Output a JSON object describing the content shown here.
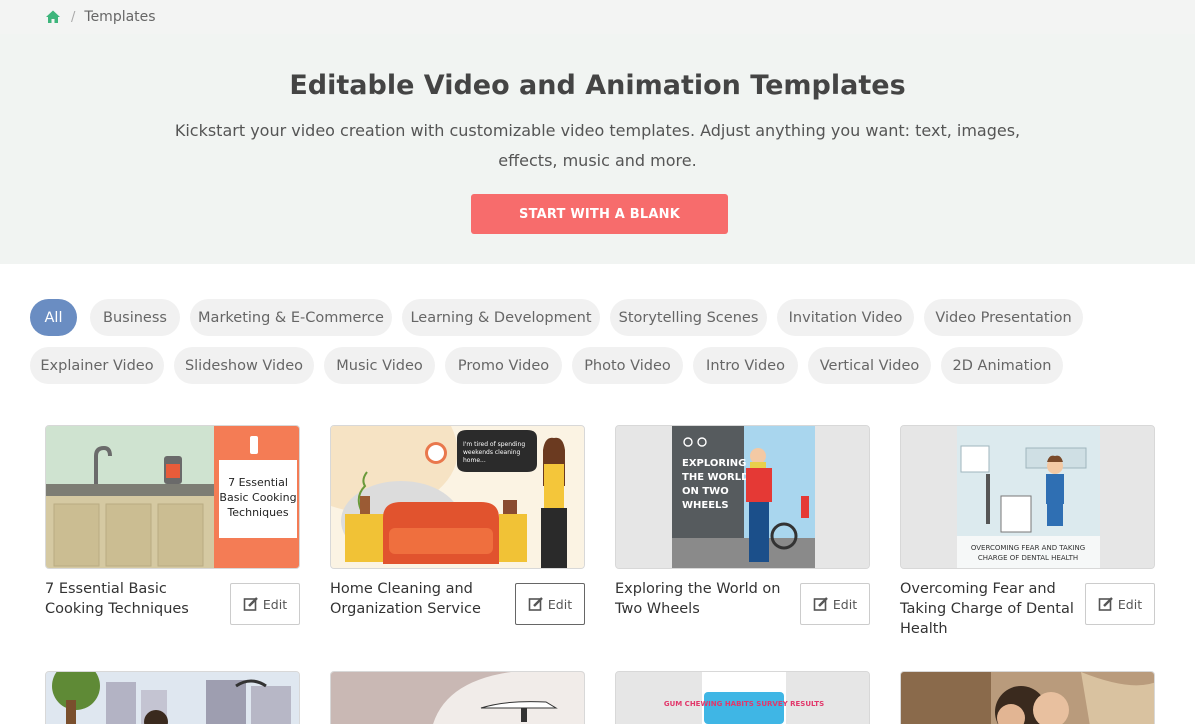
{
  "breadcrumb": {
    "home_icon": "home-icon",
    "current": "Templates"
  },
  "hero": {
    "title": "Editable Video and Animation Templates",
    "subtitle": "Kickstart your video creation with customizable video templates. Adjust anything you want: text, images, effects, music and more.",
    "button": "START WITH A BLANK",
    "button_color": "#f76c6c"
  },
  "categories": [
    "All",
    "Business",
    "Marketing & E-Commerce",
    "Learning & Development",
    "Storytelling Scenes",
    "Invitation Video",
    "Video Presentation",
    "Explainer Video",
    "Slideshow Video",
    "Music Video",
    "Promo Video",
    "Photo Video",
    "Intro Video",
    "Vertical Video",
    "2D Animation"
  ],
  "active_category": "All",
  "accent_color": "#6a8dc2",
  "templates": [
    {
      "title": "7 Essential Basic Cooking Techniques",
      "edit": "Edit",
      "thumb_text": "7 Essential Basic Cooking Techniques"
    },
    {
      "title": "Home Cleaning and Organization Service",
      "edit": "Edit",
      "thumb_text": "I'm tired of spending weekends cleaning home..."
    },
    {
      "title": "Exploring the World on Two Wheels",
      "edit": "Edit",
      "thumb_text": "EXPLORING THE WORLD ON TWO WHEELS"
    },
    {
      "title": "Overcoming Fear and Taking Charge of Dental Health",
      "edit": "Edit",
      "thumb_text": "OVERCOMING FEAR AND TAKING CHARGE OF DENTAL HEALTH"
    }
  ],
  "row2_thumb_texts": [
    "GUM CHEWING HABITS SURVEY RESULTS"
  ]
}
